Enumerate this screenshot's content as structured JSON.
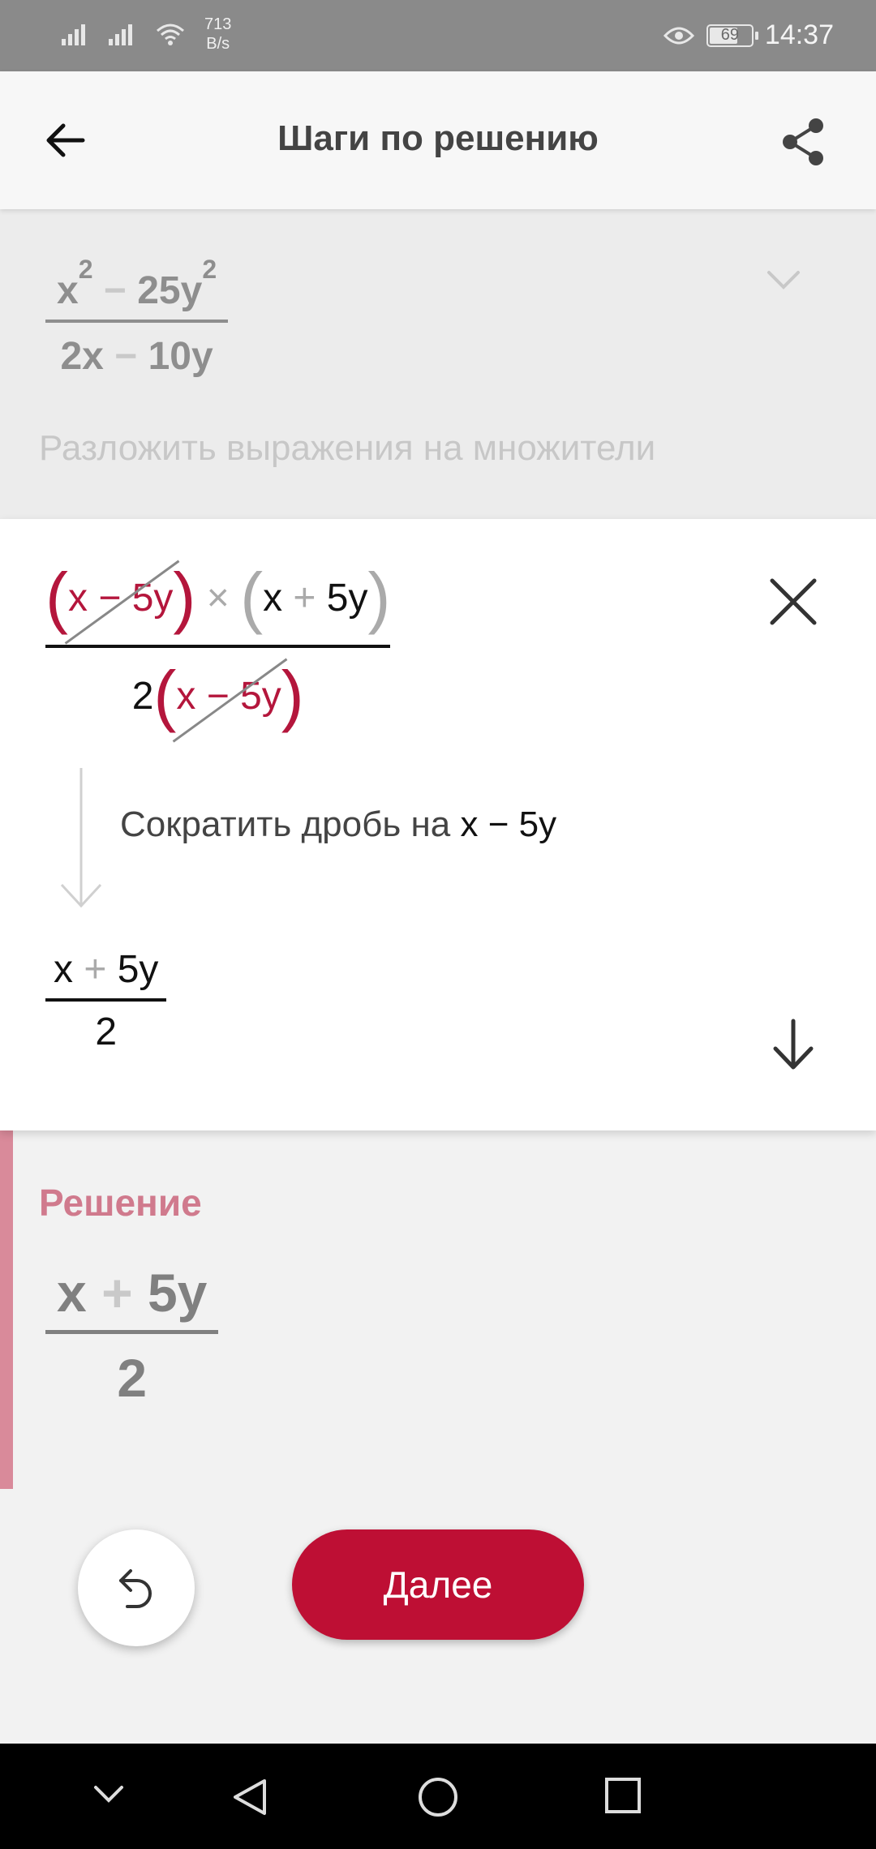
{
  "status_bar": {
    "net_speed_value": "713",
    "net_speed_unit": "B/s",
    "battery": "69",
    "time": "14:37"
  },
  "header": {
    "title": "Шаги по решению"
  },
  "original": {
    "num_x": "x",
    "num_exp1": "2",
    "num_minus": "−",
    "num_term": "25y",
    "num_exp2": "2",
    "den_a": "2x",
    "den_minus": "−",
    "den_b": "10y"
  },
  "step_label": "Разложить выражения на множители",
  "factored": {
    "open1": "(",
    "f1": "x − 5y",
    "close1": ")",
    "times": "×",
    "open2": "(",
    "f2_x": "x",
    "f2_plus": "+",
    "f2_y": "5y",
    "close2": ")",
    "den_coef": "2",
    "den_open": "(",
    "den_f": "x − 5y",
    "den_close": ")"
  },
  "action": {
    "text": "Сократить дробь на ",
    "term": "x − 5y"
  },
  "result": {
    "num_x": "x",
    "num_plus": "+",
    "num_y": "5y",
    "den": "2"
  },
  "solution": {
    "title": "Решение",
    "num_x": "x",
    "num_plus": "+",
    "num_y": "5y",
    "den": "2"
  },
  "buttons": {
    "next_label": "Далее"
  },
  "colors": {
    "accent": "#be0f34",
    "factor_red": "#b4163c",
    "solution_bar": "#d98a9a"
  }
}
